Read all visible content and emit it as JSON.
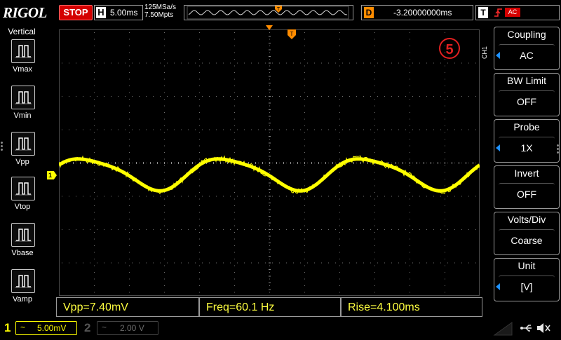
{
  "brand": "RIGOL",
  "run_state": "STOP",
  "horizontal": {
    "key": "H",
    "timebase": "5.00ms"
  },
  "sampling": {
    "rate": "125MSa/s",
    "points": "7.50Mpts"
  },
  "delay": {
    "key": "D",
    "value": "-3.20000000ms"
  },
  "trigger": {
    "key": "T",
    "slope_icon": "rising-edge-icon",
    "source": "AC"
  },
  "left_menu": {
    "title": "Vertical",
    "items": [
      {
        "label": "Vmax",
        "icon": "vmax-icon"
      },
      {
        "label": "Vmin",
        "icon": "vmin-icon"
      },
      {
        "label": "Vpp",
        "icon": "vpp-icon"
      },
      {
        "label": "Vtop",
        "icon": "vtop-icon"
      },
      {
        "label": "Vbase",
        "icon": "vbase-icon"
      },
      {
        "label": "Vamp",
        "icon": "vamp-icon"
      }
    ]
  },
  "channel_marker": "1",
  "trigger_marker": "T",
  "annotation_number": "5",
  "measurements": [
    {
      "text": "Vpp=7.40mV"
    },
    {
      "text": "Freq=60.1 Hz"
    },
    {
      "text": "Rise=4.100ms"
    }
  ],
  "right_menu": {
    "channel_tab": "CH1",
    "buttons": [
      {
        "title": "Coupling",
        "value": "AC",
        "has_arrow": true
      },
      {
        "title": "BW Limit",
        "value": "OFF",
        "has_arrow": false
      },
      {
        "title": "Probe",
        "value": "1X",
        "has_arrow": true
      },
      {
        "title": "Invert",
        "value": "OFF",
        "has_arrow": false
      },
      {
        "title": "Volts/Div",
        "value": "Coarse",
        "has_arrow": false
      },
      {
        "title": "Unit",
        "value": "[V]",
        "has_arrow": true
      }
    ]
  },
  "channels": [
    {
      "number": "1",
      "coupling_icon": "~",
      "scale": "5.00mV",
      "active": true
    },
    {
      "number": "2",
      "coupling_icon": "~",
      "scale": "2.00 V",
      "active": false
    }
  ],
  "colors": {
    "ch1": "#ffff00",
    "stop": "#d40000",
    "delay_key": "#ff8c00",
    "grid_dot": "#6e6e6e",
    "menu_arrow": "#1e90ff",
    "annotation": "#e02020"
  },
  "waveform": {
    "type": "noisy_sine",
    "frequency_hz": 60.1,
    "timebase_per_div": "5.00ms",
    "vpp": "7.40mV",
    "scale_per_div": "5.00mV"
  }
}
